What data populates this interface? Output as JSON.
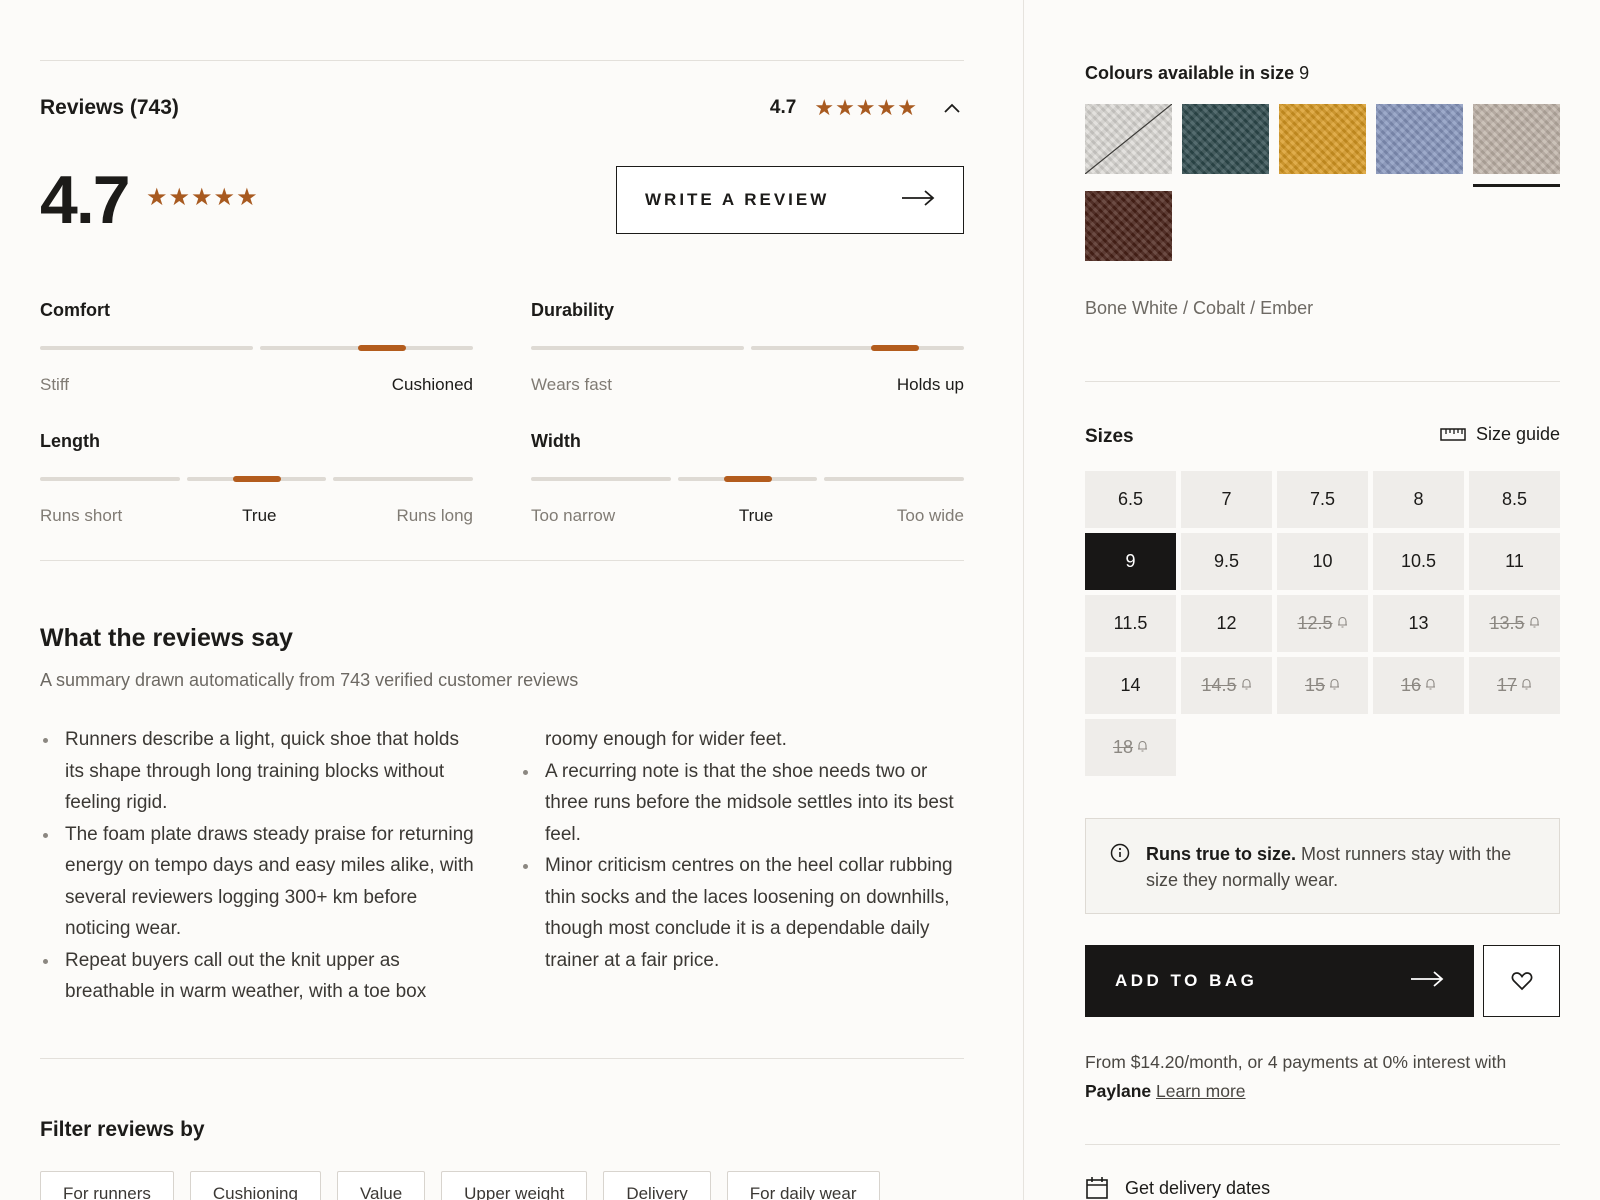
{
  "reviews": {
    "title": "Reviews (743)",
    "score": "4.7",
    "stars": 5,
    "write_label": "WRITE A REVIEW",
    "icons": {
      "collapse": "chevron-up-icon",
      "arrow": "arrow-right-icon",
      "star": "star-icon"
    }
  },
  "metrics": [
    {
      "title": "Comfort",
      "labels": [
        "Stiff",
        "Cushioned"
      ],
      "highlight": 1,
      "position": 0.79
    },
    {
      "title": "Durability",
      "labels": [
        "Wears fast",
        "Holds up"
      ],
      "highlight": 1,
      "position": 0.84
    },
    {
      "title": "Length",
      "labels": [
        "Runs short",
        "True",
        "Runs long"
      ],
      "highlight": 1,
      "position": 0.5
    },
    {
      "title": "Width",
      "labels": [
        "Too narrow",
        "True",
        "Too wide"
      ],
      "highlight": 1,
      "position": 0.5
    }
  ],
  "summary": {
    "title": "What the reviews say",
    "subtitle": "A summary drawn automatically from 743 verified customer reviews",
    "col1": [
      "Runners describe a light, quick shoe that holds its shape through long training blocks without feeling rigid.",
      "The foam plate draws steady praise for returning energy on tempo days and easy miles alike, with several reviewers logging 300+ km before noticing wear.",
      "Repeat buyers call out the knit upper as breathable in warm weather, with a toe box"
    ],
    "col2_continuation": "roomy enough for wider feet.",
    "col2": [
      "A recurring note is that the shoe needs two or three runs before the midsole settles into its best feel.",
      "Minor criticism centres on the heel collar rubbing thin socks and the laces loosening on downhills, though most conclude it is a dependable daily trainer at a fair price."
    ]
  },
  "filters": {
    "title": "Filter reviews by",
    "chips": [
      "For runners",
      "Cushioning",
      "Value",
      "Upper weight",
      "Delivery",
      "For daily wear"
    ]
  },
  "colours": {
    "label": "Colours available in size",
    "size": "9",
    "selected_name": "Bone White / Cobalt / Ember",
    "swatches": [
      {
        "name": "bone-white-swatch",
        "color": "#dcdad6",
        "unavailable": true
      },
      {
        "name": "teal-swatch",
        "color": "#2e4a4d"
      },
      {
        "name": "ember-swatch",
        "color": "#d99a22"
      },
      {
        "name": "cobalt-swatch",
        "color": "#8796be"
      },
      {
        "name": "oatmeal-swatch",
        "color": "#bfb3a8",
        "selected": true
      },
      {
        "name": "brown-swatch",
        "color": "#4a2218"
      }
    ]
  },
  "sizes": {
    "title": "Sizes",
    "guide_label": "Size guide",
    "selected": "9",
    "items": [
      {
        "label": "6.5",
        "available": true
      },
      {
        "label": "7",
        "available": true
      },
      {
        "label": "7.5",
        "available": true
      },
      {
        "label": "8",
        "available": true
      },
      {
        "label": "8.5",
        "available": true
      },
      {
        "label": "9",
        "available": true
      },
      {
        "label": "9.5",
        "available": true
      },
      {
        "label": "10",
        "available": true
      },
      {
        "label": "10.5",
        "available": true
      },
      {
        "label": "11",
        "available": true
      },
      {
        "label": "11.5",
        "available": true
      },
      {
        "label": "12",
        "available": true
      },
      {
        "label": "12.5",
        "available": false
      },
      {
        "label": "13",
        "available": true
      },
      {
        "label": "13.5",
        "available": false
      },
      {
        "label": "14",
        "available": true
      },
      {
        "label": "14.5",
        "available": false
      },
      {
        "label": "15",
        "available": false
      },
      {
        "label": "16",
        "available": false
      },
      {
        "label": "17",
        "available": false
      },
      {
        "label": "18",
        "available": false
      }
    ]
  },
  "fit_note": {
    "strong": "Runs true to size.",
    "text": "Most runners stay with the size they normally wear."
  },
  "cart": {
    "add_label": "ADD TO BAG"
  },
  "finance": {
    "text": "From $14.20/month, or 4 payments at 0% interest with",
    "brand": "Paylane",
    "link": "Learn more"
  },
  "delivery": {
    "label": "Get delivery dates"
  },
  "colors": {
    "accent": "#a85a20",
    "marker": "#b35c1d",
    "dark": "#181716"
  }
}
